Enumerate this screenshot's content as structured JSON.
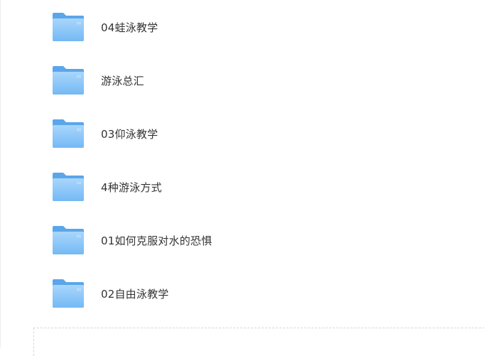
{
  "folders": [
    {
      "name": "04蛙泳教学",
      "icon": "folder-icon"
    },
    {
      "name": "游泳总汇",
      "icon": "folder-icon"
    },
    {
      "name": "03仰泳教学",
      "icon": "folder-icon"
    },
    {
      "name": "4种游泳方式",
      "icon": "folder-icon"
    },
    {
      "name": "01如何克服对水的恐惧",
      "icon": "folder-icon"
    },
    {
      "name": "02自由泳教学",
      "icon": "folder-icon"
    }
  ],
  "colors": {
    "folder_back": "#5aa6ea",
    "folder_front_top": "#9fd0fb",
    "folder_front_bottom": "#6fb6f3",
    "text": "#333333",
    "dashed_border": "#d6d6d6"
  }
}
